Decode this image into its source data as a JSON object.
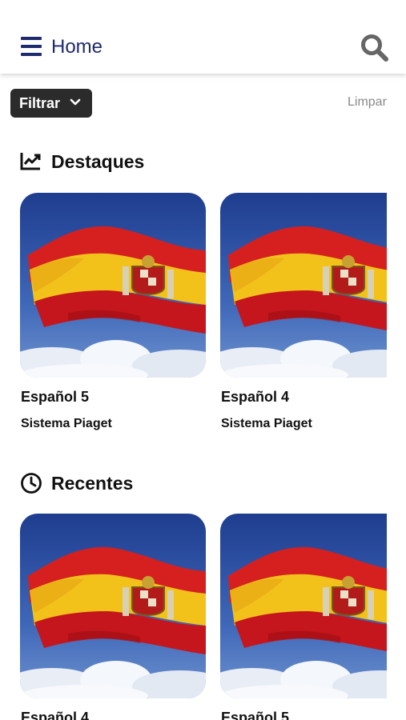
{
  "header": {
    "title": "Home",
    "menu_icon": "hamburger-menu-icon",
    "search_icon": "search-icon",
    "accent": "#1e2a6e"
  },
  "filter": {
    "label": "Filtrar",
    "clear_label": "Limpar"
  },
  "sections": {
    "highlights": {
      "title": "Destaques",
      "icon": "trending-chart-icon",
      "cards": [
        {
          "title": "Español 5",
          "subtitle": "Sistema Piaget",
          "image": "spain-flag"
        },
        {
          "title": "Español 4",
          "subtitle": "Sistema Piaget",
          "image": "spain-flag"
        }
      ]
    },
    "recent": {
      "title": "Recentes",
      "icon": "clock-icon",
      "cards": [
        {
          "title": "Español 4",
          "image": "spain-flag"
        },
        {
          "title": "Español 5",
          "image": "spain-flag"
        }
      ]
    }
  }
}
